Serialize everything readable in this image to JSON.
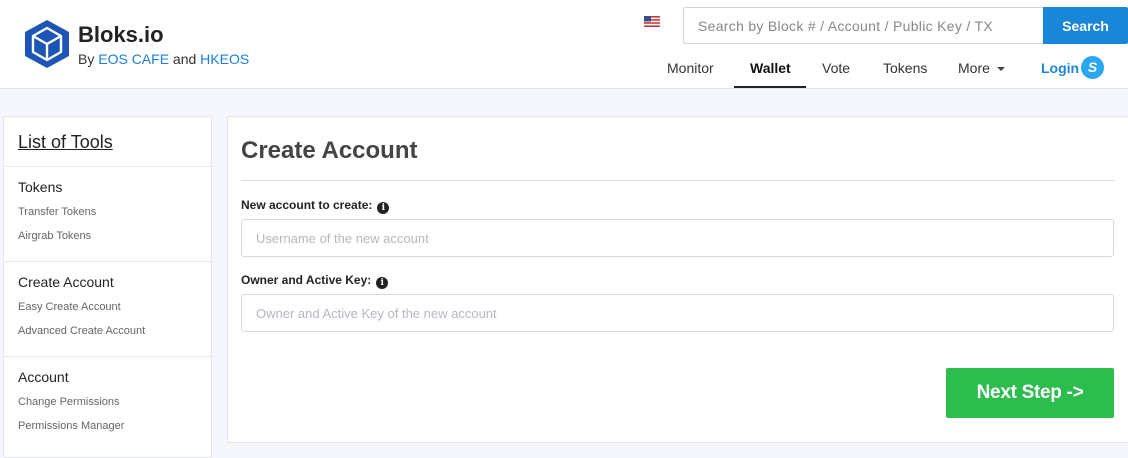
{
  "brand": {
    "name": "Bloks.io",
    "by_prefix": "By",
    "by_link1": "EOS CAFE",
    "by_and": "and",
    "by_link2": "HKEOS",
    "logo_icon": "cube-logo-icon",
    "accent_color": "#1a86d8"
  },
  "header": {
    "flag_icon": "us-flag-icon",
    "search": {
      "placeholder": "Search by Block # / Account / Public Key / TX",
      "value": "",
      "button_label": "Search"
    },
    "nav": {
      "monitor": "Monitor",
      "wallet": "Wallet",
      "vote": "Vote",
      "tokens": "Tokens",
      "more": "More",
      "active": "Wallet"
    },
    "login": {
      "label": "Login",
      "icon": "scatter-icon"
    }
  },
  "sidebar": {
    "title": "List of Tools",
    "sections": [
      {
        "title": "Tokens",
        "items": [
          "Transfer Tokens",
          "Airgrab Tokens"
        ]
      },
      {
        "title": "Create Account",
        "items": [
          "Easy Create Account",
          "Advanced Create Account"
        ]
      },
      {
        "title": "Account",
        "items": [
          "Change Permissions",
          "Permissions Manager"
        ]
      }
    ]
  },
  "main": {
    "title": "Create Account",
    "fields": [
      {
        "label": "New account to create:",
        "placeholder": "Username of the new account",
        "value": ""
      },
      {
        "label": "Owner and Active Key:",
        "placeholder": "Owner and Active Key of the new account",
        "value": ""
      }
    ],
    "info_icon": "info-icon",
    "next_button_label": "Next Step ->",
    "next_button_color": "#2dbd4f"
  }
}
